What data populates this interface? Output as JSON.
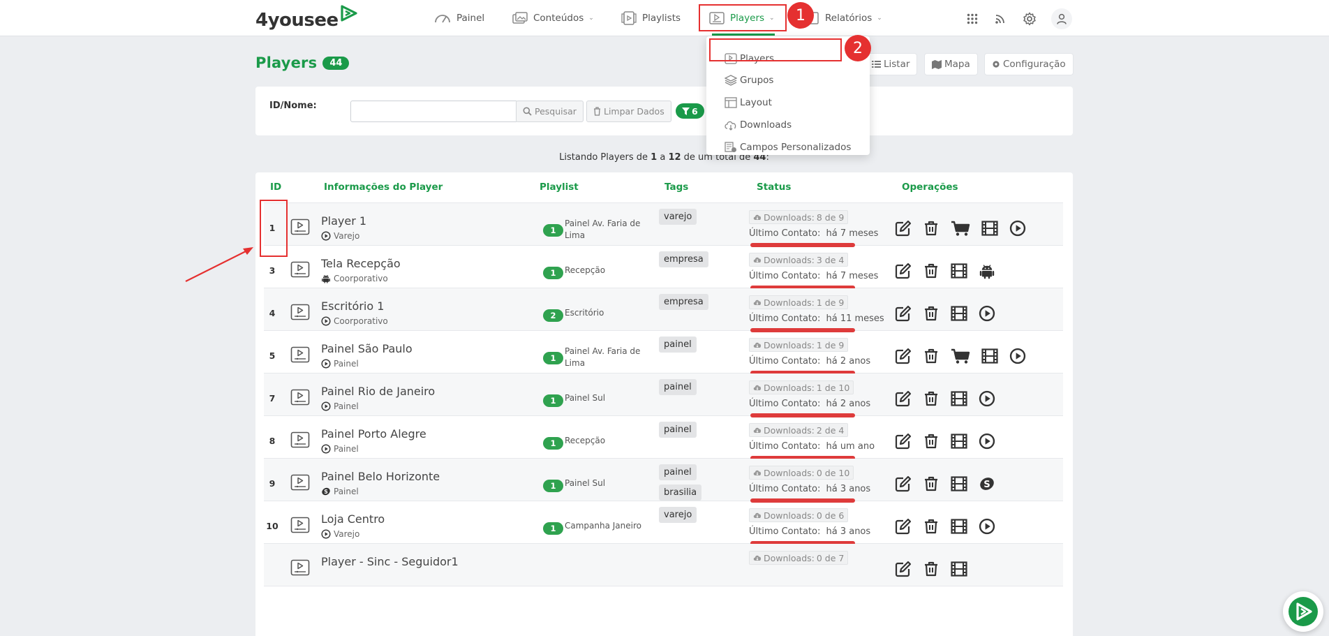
{
  "app": {
    "logo_text": "4yousee"
  },
  "nav": {
    "items": [
      {
        "label": "Painel",
        "icon": "gauge-icon"
      },
      {
        "label": "Conteúdos",
        "icon": "images-icon",
        "has_dropdown": true
      },
      {
        "label": "Playlists",
        "icon": "playlist-icon"
      },
      {
        "label": "Players",
        "icon": "player-icon",
        "has_dropdown": true,
        "active": true
      },
      {
        "label": "Relatórios",
        "icon": "report-icon",
        "has_dropdown": true
      }
    ],
    "chevron": "⌄"
  },
  "annotations": {
    "step1": "1",
    "step2": "2"
  },
  "dropdown": {
    "items": [
      {
        "label": "Players",
        "icon": "player-icon"
      },
      {
        "label": "Grupos",
        "icon": "layers-icon"
      },
      {
        "label": "Layout",
        "icon": "layout-icon"
      },
      {
        "label": "Downloads",
        "icon": "cloud-download-icon"
      },
      {
        "label": "Campos Personalizados",
        "icon": "custom-fields-icon"
      }
    ]
  },
  "page": {
    "title": "Players",
    "count": "44",
    "view_buttons": [
      {
        "label": "Listar",
        "icon": "list-icon"
      },
      {
        "label": "Mapa",
        "icon": "map-icon"
      },
      {
        "label": "Configuração",
        "icon": "gear-icon"
      }
    ]
  },
  "search": {
    "label": "ID/Nome:",
    "value": "",
    "placeholder": "",
    "search_button": "Pesquisar",
    "clear_button": "Limpar Dados",
    "filter_count": "6"
  },
  "listing": {
    "prefix": "Listando Players de ",
    "from": "1",
    "mid1": " a ",
    "to": "12",
    "mid2": " de um total de ",
    "total": "44",
    "suffix": ":"
  },
  "table": {
    "headers": [
      "ID",
      "Informações do Player",
      "Playlist",
      "Tags",
      "Status",
      "Operações"
    ],
    "downloads_prefix": "Downloads: ",
    "contact_prefix": "Último Contato: ",
    "rows": [
      {
        "id": "1",
        "name": "Player 1",
        "type": "Varejo",
        "type_icon": "play-circle-icon",
        "playlist_count": "1",
        "playlist": "Painel Av. Faria de Lima",
        "tags": [
          "varejo"
        ],
        "downloads": "8 de 9",
        "contact": "há 7 meses",
        "ops": [
          "edit-icon",
          "trash-icon",
          "cart-icon",
          "film-icon",
          "play-circle-icon"
        ]
      },
      {
        "id": "3",
        "name": "Tela Recepção",
        "type": "Coorporativo",
        "type_icon": "android-icon",
        "playlist_count": "1",
        "playlist": "Recepção",
        "tags": [
          "empresa"
        ],
        "downloads": "3 de 4",
        "contact": "há 7 meses",
        "ops": [
          "edit-icon",
          "trash-icon",
          "film-icon",
          "android-icon"
        ]
      },
      {
        "id": "4",
        "name": "Escritório 1",
        "type": "Coorporativo",
        "type_icon": "play-circle-icon",
        "playlist_count": "2",
        "playlist": "Escritório",
        "tags": [
          "empresa"
        ],
        "downloads": "1 de 9",
        "contact": "há 11 meses",
        "ops": [
          "edit-icon",
          "trash-icon",
          "film-icon",
          "play-circle-icon"
        ]
      },
      {
        "id": "5",
        "name": "Painel São Paulo",
        "type": "Painel",
        "type_icon": "play-circle-icon",
        "playlist_count": "1",
        "playlist": "Painel Av. Faria de Lima",
        "tags": [
          "painel"
        ],
        "downloads": "1 de 9",
        "contact": "há 2 anos",
        "ops": [
          "edit-icon",
          "trash-icon",
          "cart-icon",
          "film-icon",
          "play-circle-icon"
        ]
      },
      {
        "id": "7",
        "name": "Painel Rio de Janeiro",
        "type": "Painel",
        "type_icon": "play-circle-icon",
        "playlist_count": "1",
        "playlist": "Painel Sul",
        "tags": [
          "painel"
        ],
        "downloads": "1 de 10",
        "contact": "há 2 anos",
        "ops": [
          "edit-icon",
          "trash-icon",
          "film-icon",
          "play-circle-icon"
        ]
      },
      {
        "id": "8",
        "name": "Painel Porto Alegre",
        "type": "Painel",
        "type_icon": "play-circle-icon",
        "playlist_count": "1",
        "playlist": "Recepção",
        "tags": [
          "painel"
        ],
        "downloads": "2 de 4",
        "contact": "há um ano",
        "ops": [
          "edit-icon",
          "trash-icon",
          "film-icon",
          "play-circle-icon"
        ]
      },
      {
        "id": "9",
        "name": "Painel Belo Horizonte",
        "type": "Painel",
        "type_icon": "signage-os-icon",
        "playlist_count": "1",
        "playlist": "Painel Sul",
        "tags": [
          "painel",
          "brasilia"
        ],
        "downloads": "0 de 10",
        "contact": "há 3 anos",
        "ops": [
          "edit-icon",
          "trash-icon",
          "film-icon",
          "signage-os-icon"
        ]
      },
      {
        "id": "10",
        "name": "Loja Centro",
        "type": "Varejo",
        "type_icon": "play-circle-icon",
        "playlist_count": "1",
        "playlist": "Campanha Janeiro",
        "tags": [
          "varejo"
        ],
        "downloads": "0 de 6",
        "contact": "há 3 anos",
        "ops": [
          "edit-icon",
          "trash-icon",
          "film-icon",
          "play-circle-icon"
        ]
      },
      {
        "id": "",
        "name": "Player - Sinc - Seguidor1",
        "type": "",
        "type_icon": "",
        "playlist_count": "",
        "playlist": "",
        "tags": [],
        "downloads": "0 de 7",
        "contact": "",
        "ops": [
          "edit-icon",
          "trash-icon",
          "film-icon"
        ]
      }
    ]
  },
  "colors": {
    "brand_green": "#1a9a49",
    "status_red": "#de3b3b",
    "annotation_red": "#e53030"
  }
}
